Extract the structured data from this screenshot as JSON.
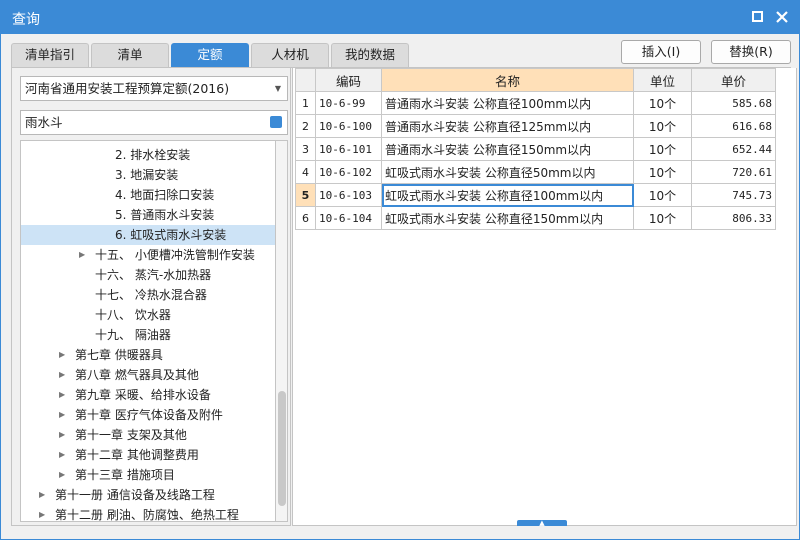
{
  "window": {
    "title": "查询"
  },
  "tabs": [
    "清单指引",
    "清单",
    "定额",
    "人材机",
    "我的数据"
  ],
  "actions": {
    "insert": "插入(I)",
    "replace": "替换(R)"
  },
  "library": {
    "selected": "河南省通用安装工程预算定额(2016)"
  },
  "search": {
    "value": "雨水斗"
  },
  "tree": [
    {
      "label": "2. 排水栓安装",
      "indent": 4,
      "arrow": false,
      "selected": false
    },
    {
      "label": "3. 地漏安装",
      "indent": 4,
      "arrow": false,
      "selected": false
    },
    {
      "label": "4. 地面扫除口安装",
      "indent": 4,
      "arrow": false,
      "selected": false
    },
    {
      "label": "5. 普通雨水斗安装",
      "indent": 4,
      "arrow": false,
      "selected": false
    },
    {
      "label": "6. 虹吸式雨水斗安装",
      "indent": 4,
      "arrow": false,
      "selected": true
    },
    {
      "label": "十五、 小便槽冲洗管制作安装",
      "indent": 3,
      "arrow": true,
      "selected": false
    },
    {
      "label": "十六、 蒸汽-水加热器",
      "indent": 3,
      "arrow": false,
      "selected": false
    },
    {
      "label": "十七、 冷热水混合器",
      "indent": 3,
      "arrow": false,
      "selected": false
    },
    {
      "label": "十八、 饮水器",
      "indent": 3,
      "arrow": false,
      "selected": false
    },
    {
      "label": "十九、 隔油器",
      "indent": 3,
      "arrow": false,
      "selected": false
    },
    {
      "label": "第七章 供暖器具",
      "indent": 2,
      "arrow": true,
      "selected": false
    },
    {
      "label": "第八章 燃气器具及其他",
      "indent": 2,
      "arrow": true,
      "selected": false
    },
    {
      "label": "第九章 采暖、给排水设备",
      "indent": 2,
      "arrow": true,
      "selected": false
    },
    {
      "label": "第十章 医疗气体设备及附件",
      "indent": 2,
      "arrow": true,
      "selected": false
    },
    {
      "label": "第十一章 支架及其他",
      "indent": 2,
      "arrow": true,
      "selected": false
    },
    {
      "label": "第十二章 其他调整费用",
      "indent": 2,
      "arrow": true,
      "selected": false
    },
    {
      "label": "第十三章 措施项目",
      "indent": 2,
      "arrow": true,
      "selected": false
    },
    {
      "label": "第十一册 通信设备及线路工程",
      "indent": 1,
      "arrow": true,
      "selected": false
    },
    {
      "label": "第十二册 刷油、防腐蚀、绝热工程",
      "indent": 1,
      "arrow": true,
      "selected": false
    }
  ],
  "grid": {
    "headers": {
      "code": "编码",
      "name": "名称",
      "unit": "单位",
      "price": "单价"
    },
    "current_row": 5,
    "rows": [
      {
        "no": "1",
        "code": "10-6-99",
        "name": "普通雨水斗安装 公称直径100mm以内",
        "unit": "10个",
        "price": "585.68"
      },
      {
        "no": "2",
        "code": "10-6-100",
        "name": "普通雨水斗安装 公称直径125mm以内",
        "unit": "10个",
        "price": "616.68"
      },
      {
        "no": "3",
        "code": "10-6-101",
        "name": "普通雨水斗安装 公称直径150mm以内",
        "unit": "10个",
        "price": "652.44"
      },
      {
        "no": "4",
        "code": "10-6-102",
        "name": "虹吸式雨水斗安装 公称直径50mm以内",
        "unit": "10个",
        "price": "720.61"
      },
      {
        "no": "5",
        "code": "10-6-103",
        "name": "虹吸式雨水斗安装 公称直径100mm以内",
        "unit": "10个",
        "price": "745.73"
      },
      {
        "no": "6",
        "code": "10-6-104",
        "name": "虹吸式雨水斗安装 公称直径150mm以内",
        "unit": "10个",
        "price": "806.33"
      }
    ]
  },
  "colors": {
    "accent": "#3b8ad6",
    "selection": "#cde3f6",
    "current_row": "#ffe0b8"
  }
}
